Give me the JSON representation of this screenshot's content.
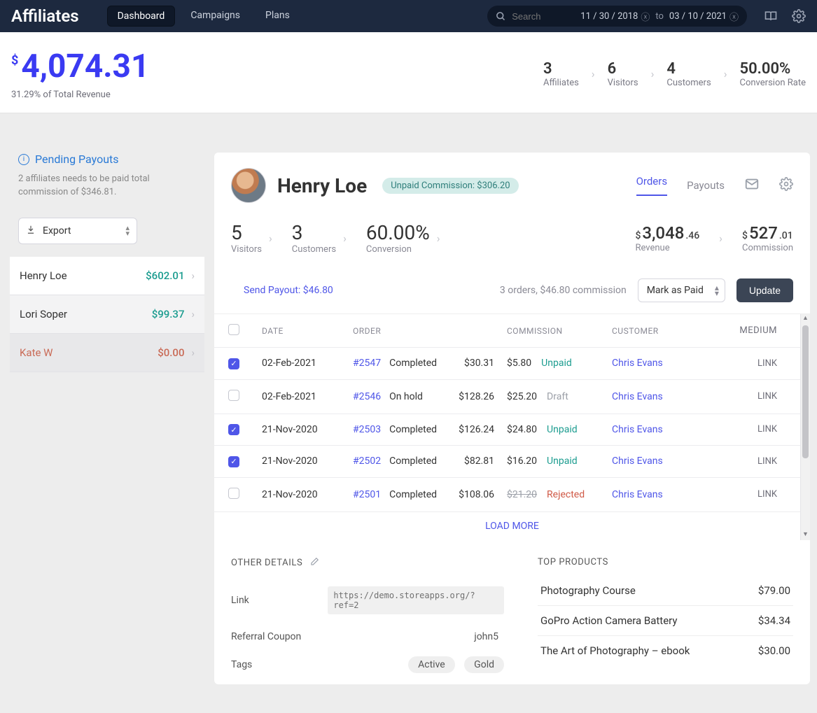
{
  "header": {
    "brand": "Affiliates",
    "tabs": {
      "dashboard": "Dashboard",
      "campaigns": "Campaigns",
      "plans": "Plans"
    },
    "search_placeholder": "Search",
    "date_from": "11 / 30 / 2018",
    "date_to": "03 / 10 / 2021",
    "date_sep": "to"
  },
  "summary": {
    "currency": "$",
    "amount": "4,074.31",
    "sub": "31.29% of Total Revenue",
    "funnel": [
      {
        "v": "3",
        "l": "Affiliates"
      },
      {
        "v": "6",
        "l": "Visitors"
      },
      {
        "v": "4",
        "l": "Customers"
      },
      {
        "v": "50.00%",
        "l": "Conversion Rate"
      }
    ]
  },
  "sidebar": {
    "pending_title": "Pending Payouts",
    "pending_sub": "2 affiliates needs to be paid total commission of $346.81.",
    "export": "Export",
    "items": [
      {
        "name": "Henry Loe",
        "amt": "$602.01",
        "zero": false
      },
      {
        "name": "Lori Soper",
        "amt": "$99.37",
        "zero": false
      },
      {
        "name": "Kate W",
        "amt": "$0.00",
        "zero": true
      }
    ]
  },
  "panel": {
    "name": "Henry Loe",
    "badge": "Unpaid Commission: $306.20",
    "tabs": {
      "orders": "Orders",
      "payouts": "Payouts"
    },
    "stats": {
      "visitors": {
        "v": "5",
        "l": "Visitors"
      },
      "customers": {
        "v": "3",
        "l": "Customers"
      },
      "conversion": {
        "v": "60.00%",
        "l": "Conversion"
      },
      "revenue": {
        "cur": "$",
        "whole": "3,048",
        "frac": ".46",
        "l": "Revenue"
      },
      "commission": {
        "cur": "$",
        "whole": "527",
        "frac": ".01",
        "l": "Commission"
      }
    },
    "payout": {
      "send": "Send Payout: $46.80",
      "summary": "3 orders, $46.80 commission",
      "select": "Mark as Paid",
      "update": "Update"
    },
    "table": {
      "head": {
        "date": "DATE",
        "order": "ORDER",
        "commission": "COMMISSION",
        "customer": "CUSTOMER",
        "medium": "MEDIUM"
      },
      "rows": [
        {
          "checked": true,
          "date": "02-Feb-2021",
          "order": "#2547",
          "ostatus": "Completed",
          "oamt": "$30.31",
          "comm": "$5.80",
          "cstat": "Unpaid",
          "cust": "Chris Evans",
          "med": "LINK"
        },
        {
          "checked": false,
          "date": "02-Feb-2021",
          "order": "#2546",
          "ostatus": "On hold",
          "oamt": "$128.26",
          "comm": "$25.20",
          "cstat": "Draft",
          "cust": "Chris Evans",
          "med": "LINK"
        },
        {
          "checked": true,
          "date": "21-Nov-2020",
          "order": "#2503",
          "ostatus": "Completed",
          "oamt": "$126.24",
          "comm": "$24.80",
          "cstat": "Unpaid",
          "cust": "Chris Evans",
          "med": "LINK"
        },
        {
          "checked": true,
          "date": "21-Nov-2020",
          "order": "#2502",
          "ostatus": "Completed",
          "oamt": "$82.81",
          "comm": "$16.20",
          "cstat": "Unpaid",
          "cust": "Chris Evans",
          "med": "LINK"
        },
        {
          "checked": false,
          "date": "21-Nov-2020",
          "order": "#2501",
          "ostatus": "Completed",
          "oamt": "$108.06",
          "comm": "$21.20",
          "cstat": "Rejected",
          "cust": "Chris Evans",
          "med": "LINK",
          "strike": true
        }
      ],
      "load_more": "LOAD MORE"
    },
    "other": {
      "title": "OTHER DETAILS",
      "link_label": "Link",
      "link_value": "https://demo.storeapps.org/?ref=2",
      "coupon_label": "Referral Coupon",
      "coupon_value": "john5",
      "tags_label": "Tags",
      "tags": [
        "Active",
        "Gold"
      ]
    },
    "products": {
      "title": "TOP PRODUCTS",
      "rows": [
        {
          "name": "Photography Course",
          "amt": "$79.00"
        },
        {
          "name": "GoPro Action Camera Battery",
          "amt": "$34.34"
        },
        {
          "name": "The Art of Photography – ebook",
          "amt": "$30.00"
        }
      ]
    }
  }
}
